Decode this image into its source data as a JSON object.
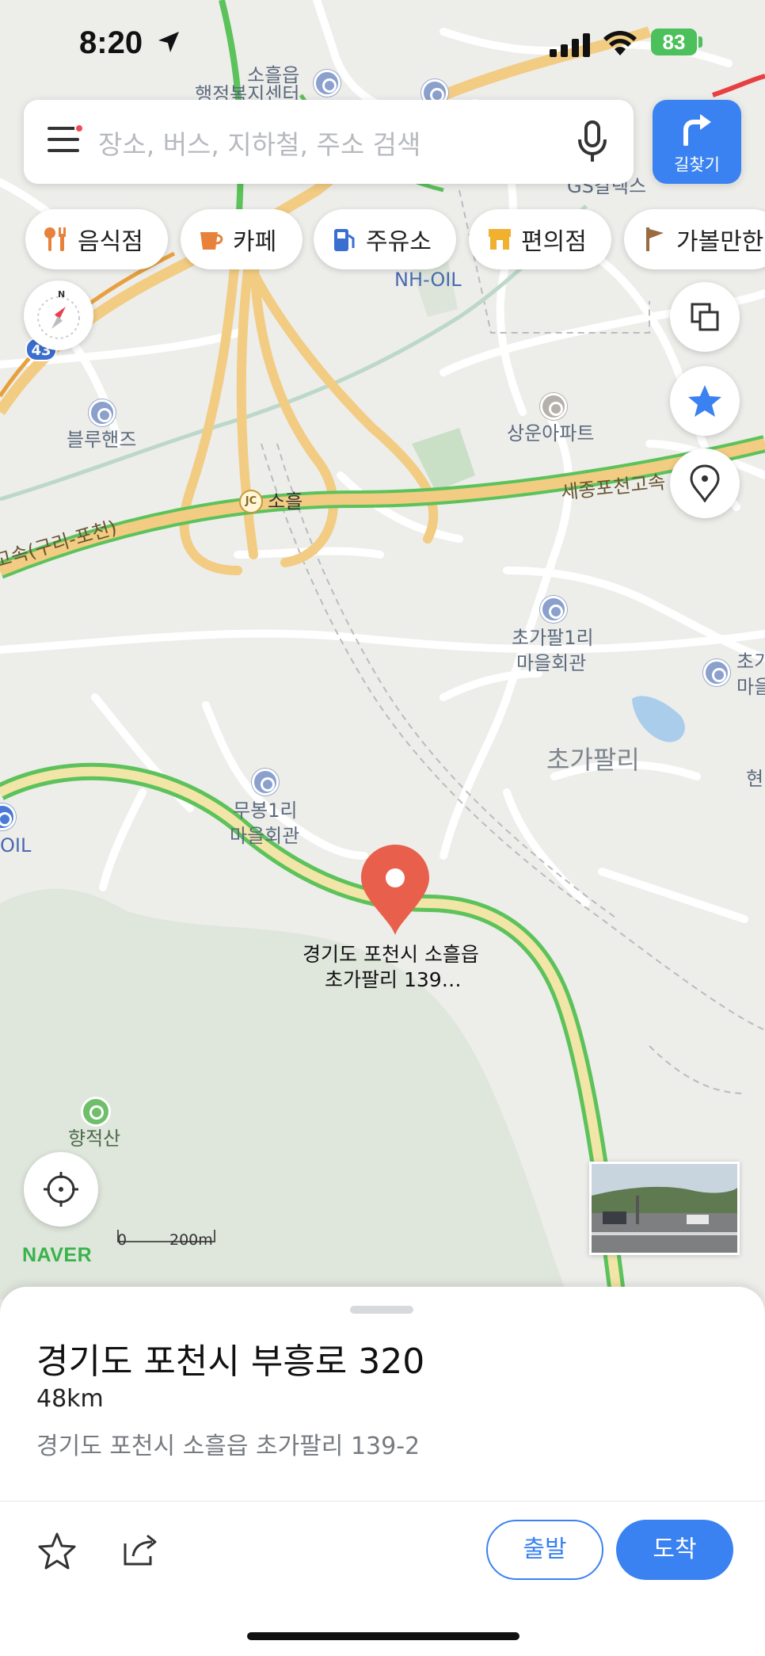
{
  "status_bar": {
    "time": "8:20",
    "battery": "83"
  },
  "search": {
    "placeholder": "장소, 버스, 지하철, 주소 검색"
  },
  "route_button": {
    "label": "길찾기"
  },
  "categories": [
    {
      "label": "음식점",
      "icon": "fork-spoon-icon",
      "color": "#e8813a"
    },
    {
      "label": "카페",
      "icon": "coffee-cup-icon",
      "color": "#e8813a"
    },
    {
      "label": "주유소",
      "icon": "fuel-pump-icon",
      "color": "#3a6fd0"
    },
    {
      "label": "편의점",
      "icon": "store-icon",
      "color": "#f0b030"
    },
    {
      "label": "가볼만한",
      "icon": "flag-icon",
      "color": "#9a6a40"
    }
  ],
  "map": {
    "labels": {
      "sohwel_eup": "소흘읍",
      "admin_center": "행정복지센터",
      "gs_caltex": "GS칼텍스",
      "nh_oil": "NH-OIL",
      "blue_hands": "블루핸즈",
      "sangun_apt": "상운아파트",
      "jc_name": "소흘",
      "jc_badge": "JC",
      "route_43": "43",
      "sejong_expressway": "세종포천고속",
      "guri_pocheon_expressway": "고속(구리-포천)",
      "chogapal_1ri": "초가팔1리",
      "chogapal_1ri_hall": "마을회관",
      "chogapal_area": "초가팔리",
      "mubong_1ri": "무봉1리",
      "mubong_1ri_hall": "마을회관",
      "right_edge_poi1": "초가",
      "right_edge_poi2": "마을",
      "right_edge_hyun": "현",
      "oil_left": "OIL",
      "hyangjeoksan": "향적산",
      "marker_line1": "경기도 포천시 소흘읍",
      "marker_line2": "초가팔리 139…"
    },
    "scale": {
      "zero": "0",
      "distance": "200m"
    },
    "logo": "NAVER"
  },
  "place": {
    "title": "경기도 포천시 부흥로 320",
    "distance": "48km",
    "address": "경기도 포천시 소흘읍 초가팔리 139-2"
  },
  "actions": {
    "start": "출발",
    "arrive": "도착"
  },
  "colors": {
    "accent": "#3a82f1",
    "marker": "#e8604c",
    "expressway": "#f2cc82",
    "traffic_green": "#5cc25a"
  }
}
